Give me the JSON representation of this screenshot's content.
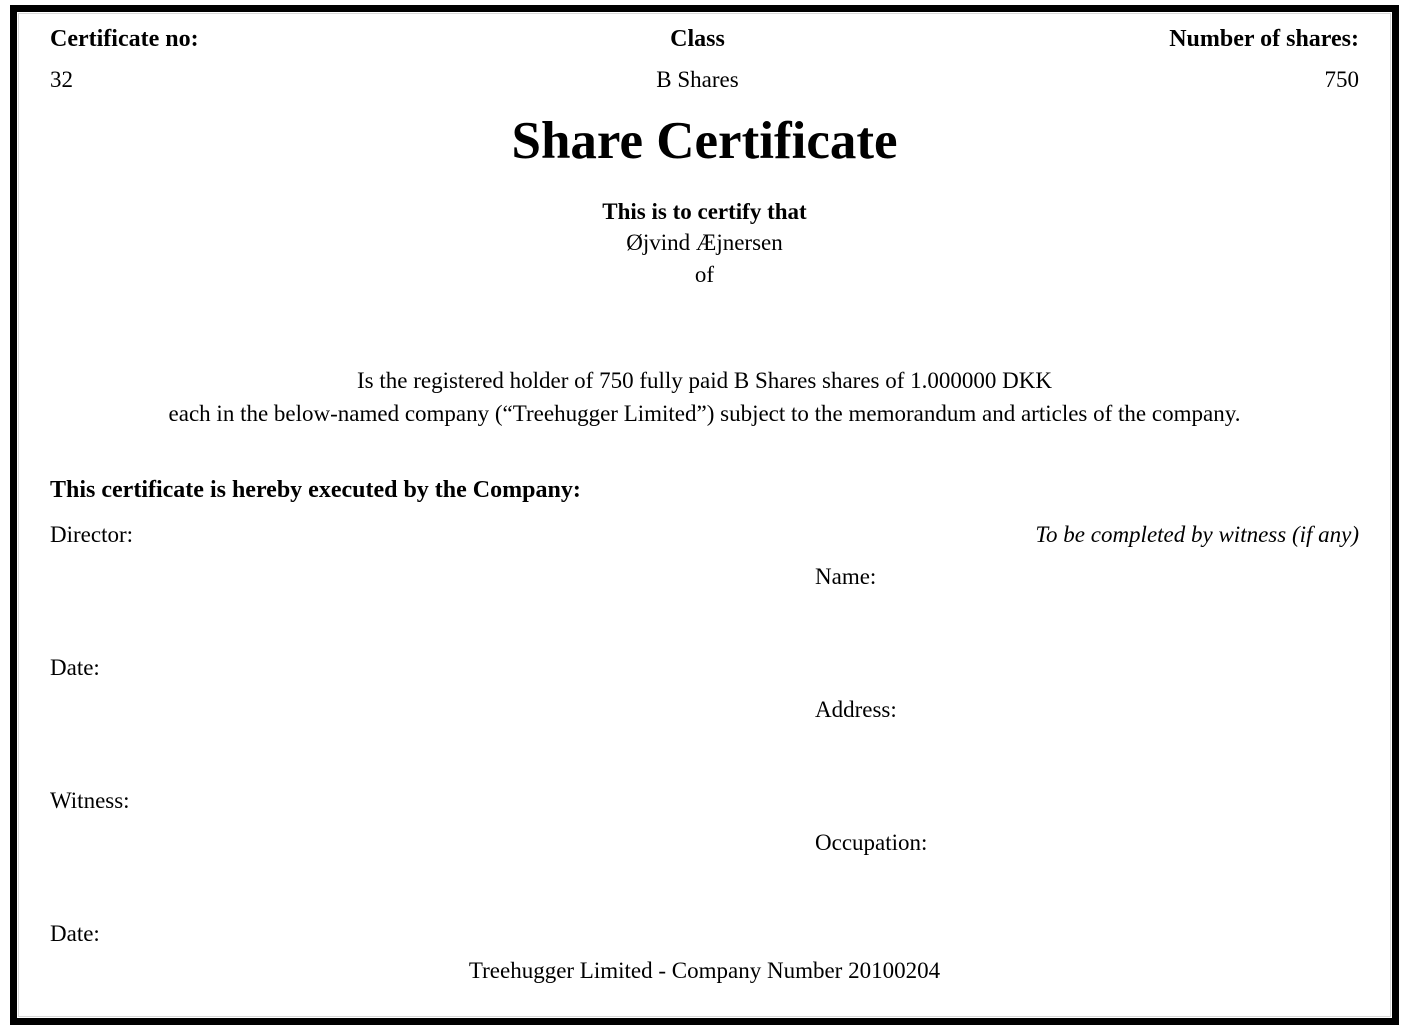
{
  "header": {
    "certificate_no_label": "Certificate no:",
    "certificate_no_value": "32",
    "class_label": "Class",
    "class_value": "B Shares",
    "number_of_shares_label": "Number of shares:",
    "number_of_shares_value": "750"
  },
  "title": "Share Certificate",
  "certify": {
    "lead": "This is to certify that",
    "holder_name": "Øjvind Æjnersen",
    "of": "of",
    "company_name": ""
  },
  "holder_statement": {
    "line1": "Is the registered holder of 750 fully paid B Shares shares of 1.000000 DKK",
    "line2": "each in the below-named company (“Treehugger Limited”) subject to the memorandum and articles of the company."
  },
  "execution": {
    "heading": "This certificate is hereby executed by the Company:",
    "left_fields": [
      {
        "label": "Director:"
      },
      {
        "label": "Date:"
      },
      {
        "label": "Witness:"
      },
      {
        "label": "Date:"
      }
    ],
    "witness_header": "To be completed by witness (if any)",
    "right_fields": [
      {
        "label": "Name:"
      },
      {
        "label": "Address:"
      },
      {
        "label": "Occupation:"
      }
    ]
  },
  "footer": "Treehugger Limited - Company Number 20100204",
  "colors": {
    "text": "#000000",
    "frame": "#000000",
    "inner_rule": "#d8d8d8",
    "background": "#ffffff"
  }
}
